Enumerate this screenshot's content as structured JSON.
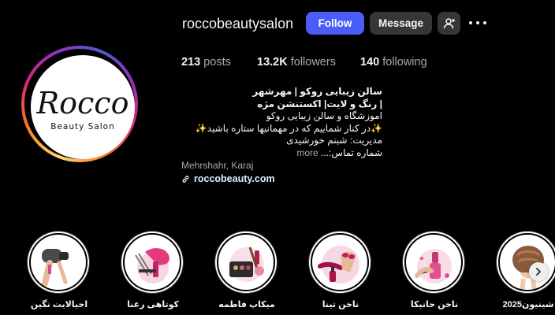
{
  "profile": {
    "username": "roccobeautysalon",
    "avatar_title": "Rocco",
    "avatar_subtitle": "Beauty Salon",
    "buttons": {
      "follow": "Follow",
      "message": "Message"
    }
  },
  "stats": {
    "posts": {
      "value": "213",
      "label": "posts"
    },
    "followers": {
      "value": "13.2K",
      "label": "followers"
    },
    "following": {
      "value": "140",
      "label": "following"
    }
  },
  "bio": {
    "name_line1": "سالن زیبایی روکو | مهرشهر",
    "name_line2": "| رنگ و لایت| اکستنشن مژه",
    "line1": "اموزشگاه و سالن زیبایی روکو",
    "line2": "در کنار شماییم که در مهمانیها ستاره باشید",
    "line3": "مدیریت: شبنم خورشیدی",
    "line4": "شماره تماس:...",
    "more": "more",
    "location": "Mehrshahr, Karaj",
    "website": "roccobeauty.com"
  },
  "highlights": [
    {
      "label": "احیالایت نگین"
    },
    {
      "label": "کوتاهی رعنا"
    },
    {
      "label": "میکاپ فاطمه"
    },
    {
      "label": "ناخن تینا"
    },
    {
      "label": "ناخن حانیکا"
    },
    {
      "label": "شینیون2025"
    }
  ],
  "colors": {
    "accent": "#4a5df9",
    "background": "#000000",
    "secondary_button": "#363636",
    "muted_text": "#a8a8a8"
  }
}
